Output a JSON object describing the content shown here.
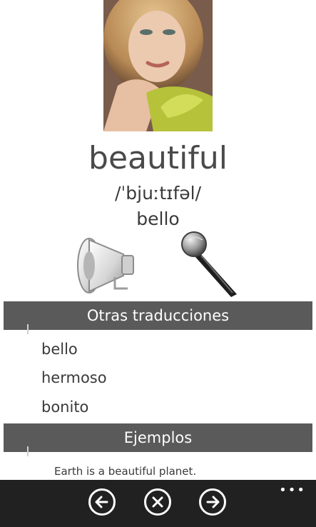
{
  "word": "beautiful",
  "phonetic": "/ˈbjuːtɪfəl/",
  "translation": "bello",
  "sections": {
    "other_translations_title": "Otras traducciones",
    "other_translations": [
      "bello",
      "hermoso",
      "bonito"
    ],
    "examples_title": "Ejemplos",
    "example_1": "Earth is a beautiful planet."
  },
  "app_bar": {
    "more": "•••"
  },
  "icons": {
    "speaker": "megaphone-speaker-icon",
    "microphone": "microphone-icon",
    "back": "arrow-left-icon",
    "close": "close-icon",
    "forward": "arrow-right-icon"
  },
  "colors": {
    "section_bar": "#5a5a5a",
    "app_bar": "#212121",
    "text": "#3a3a3a"
  }
}
